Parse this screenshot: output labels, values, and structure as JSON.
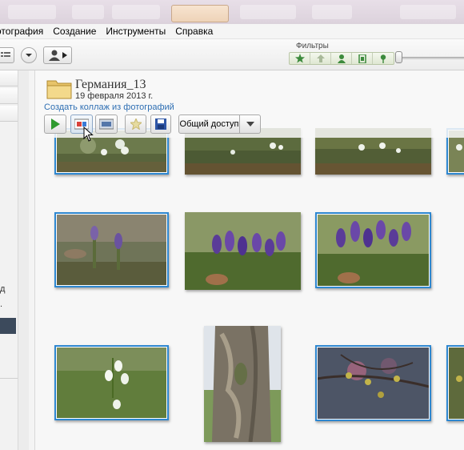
{
  "menu": {
    "items": [
      "отография",
      "Создание",
      "Инструменты",
      "Справка"
    ]
  },
  "toolbar": {
    "filters_label": "Фильтры"
  },
  "album": {
    "title": "Германия_13",
    "date": "19 февраля 2013 г.",
    "tooltip": "Создать коллаж из фотографий",
    "share_label": "Общий доступ"
  },
  "leftpanel": {
    "cut_text_1": "д",
    "cut_text_2": "."
  },
  "colors": {
    "selection": "#2e87d0",
    "link": "#2f6fb3",
    "filter_green": "#3c8a3c"
  },
  "photos": [
    {
      "name": "snowdrops-1",
      "selected": true
    },
    {
      "name": "snowdrops-2",
      "selected": false
    },
    {
      "name": "snowdrops-3",
      "selected": false
    },
    {
      "name": "snowdrops-4",
      "selected": false
    },
    {
      "name": "crocus-1",
      "selected": true
    },
    {
      "name": "crocus-2",
      "selected": false
    },
    {
      "name": "crocus-3",
      "selected": true
    },
    {
      "name": "snowflakes",
      "selected": true
    },
    {
      "name": "tree-trunk",
      "selected": false
    },
    {
      "name": "branch-buds",
      "selected": true
    },
    {
      "name": "partial-photo",
      "selected": true
    }
  ]
}
